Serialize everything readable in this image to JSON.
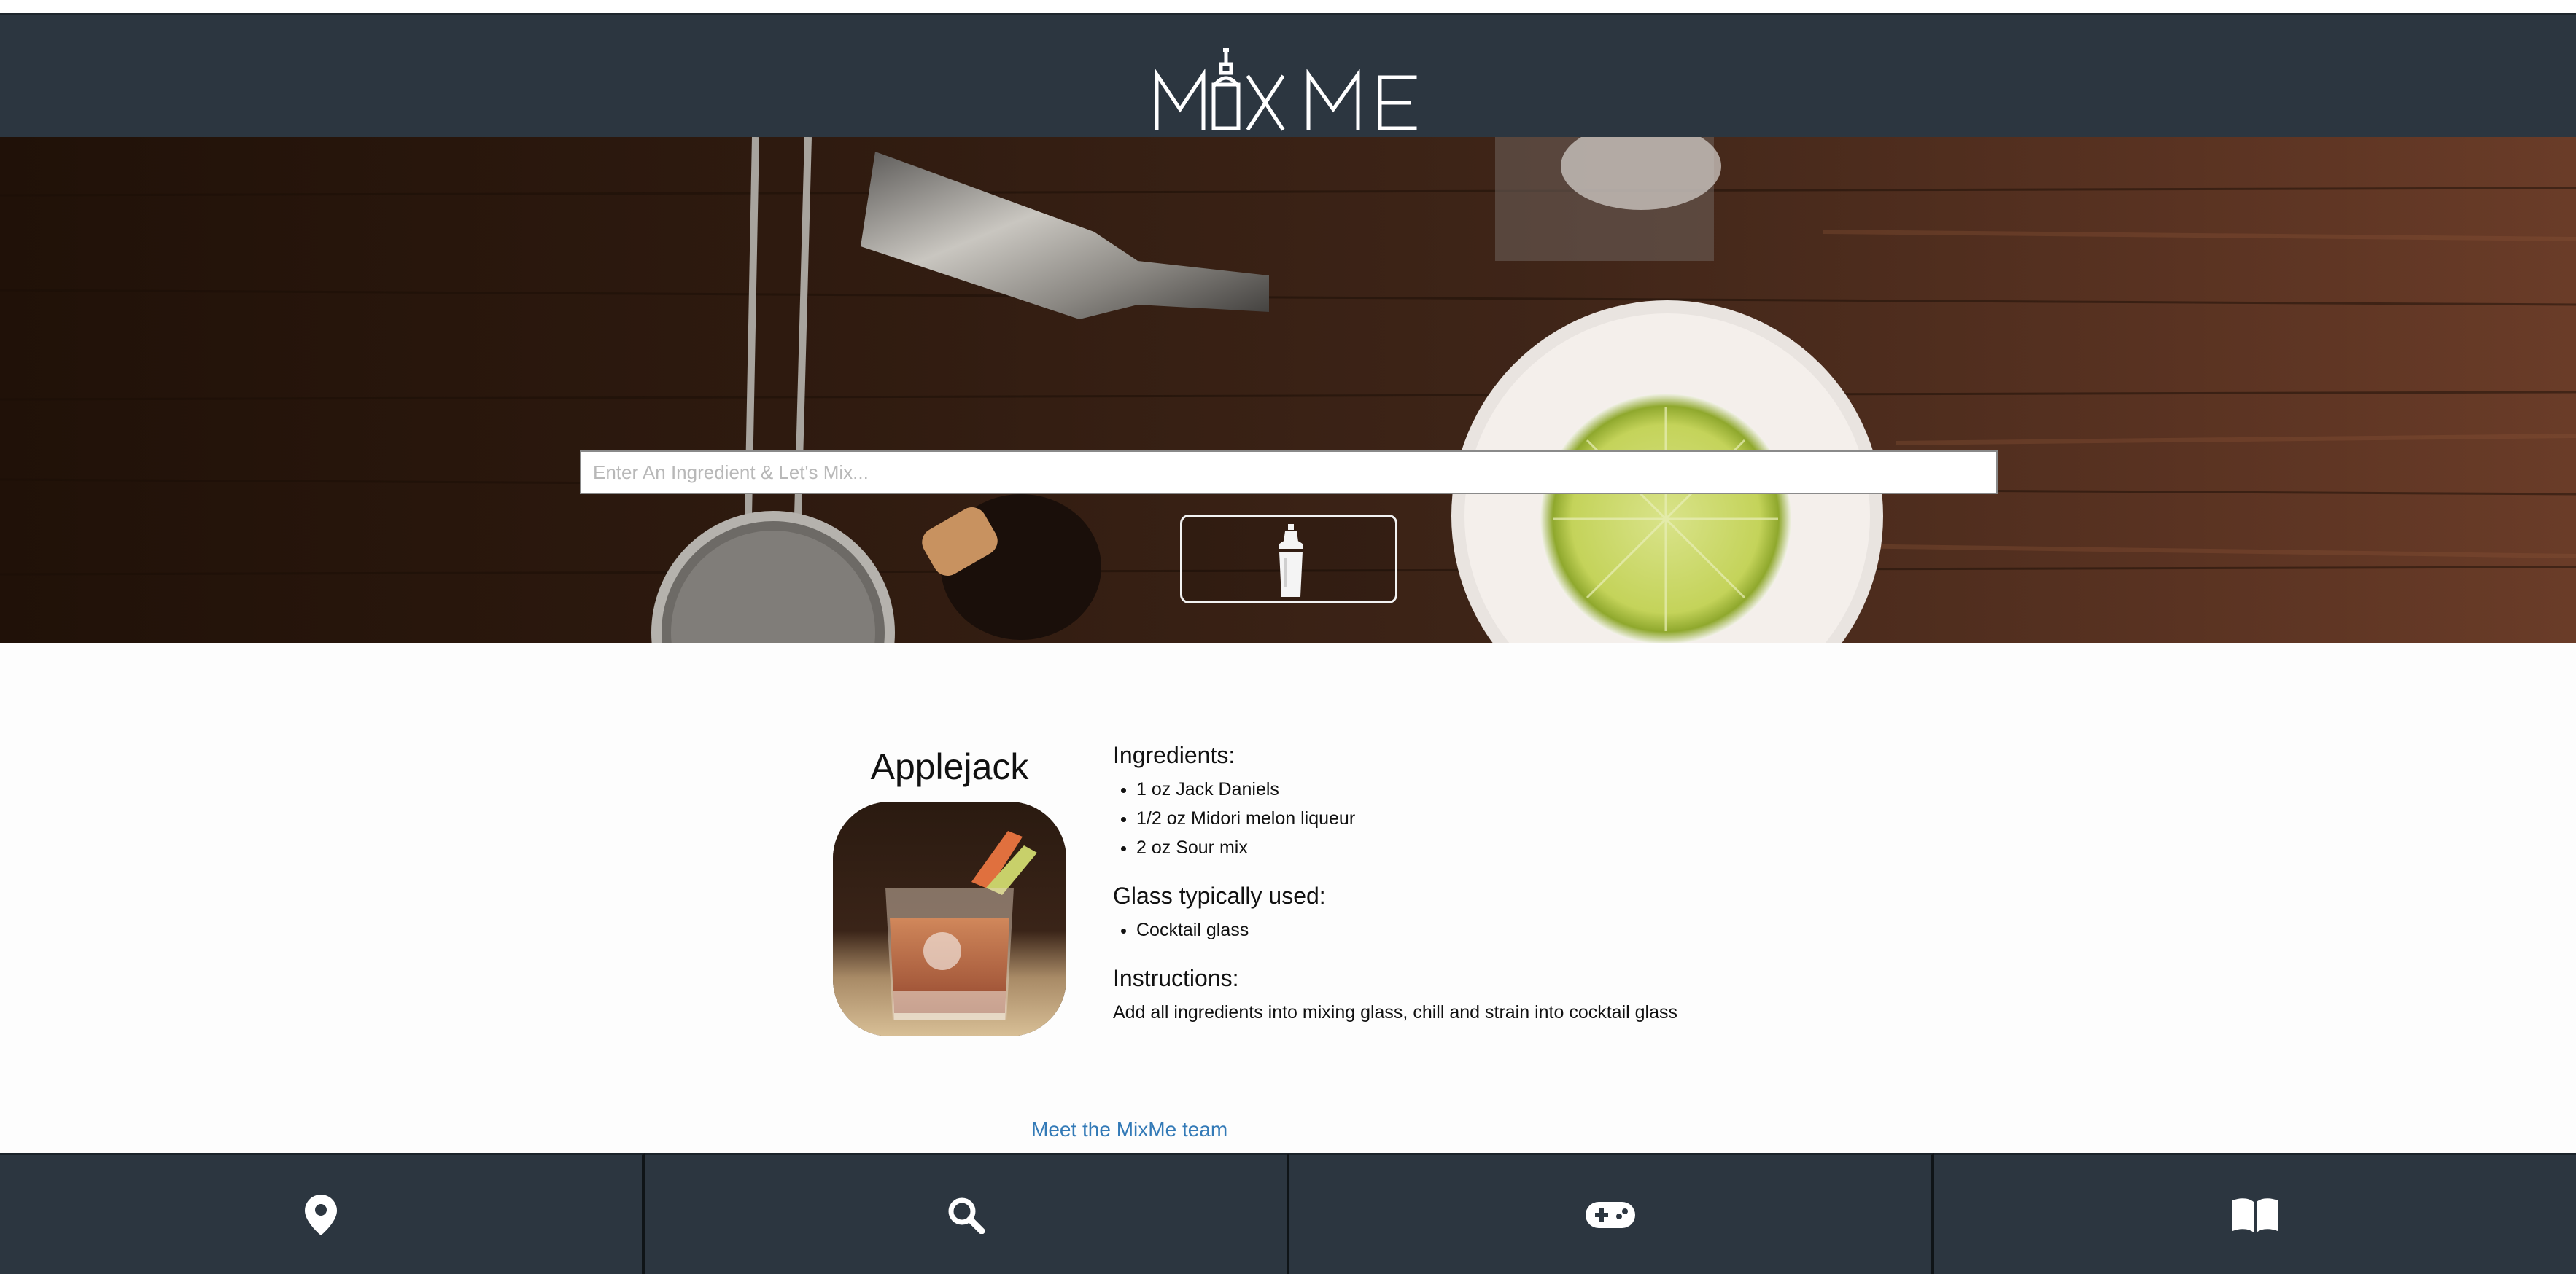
{
  "app": {
    "logo_text": "MIXME"
  },
  "search": {
    "placeholder": "Enter An Ingredient & Let's Mix...",
    "value": ""
  },
  "drink": {
    "name": "Applejack",
    "ingredients_heading": "Ingredients:",
    "ingredients": [
      "1 oz Jack Daniels",
      "1/2 oz Midori melon liqueur",
      "2 oz Sour mix"
    ],
    "glass_heading": "Glass typically used:",
    "glass": [
      "Cocktail glass"
    ],
    "instructions_heading": "Instructions:",
    "instructions": "Add all ingredients into mixing glass, chill and strain into cocktail glass"
  },
  "footer": {
    "team_link": "Meet the MixMe team"
  },
  "nav": {
    "items": [
      {
        "icon": "map-marker-icon"
      },
      {
        "icon": "search-icon"
      },
      {
        "icon": "gamepad-icon"
      },
      {
        "icon": "book-icon"
      }
    ]
  },
  "colors": {
    "header_bg": "#2c3640",
    "link": "#337ab7",
    "page_bg": "#fdfdfd"
  }
}
